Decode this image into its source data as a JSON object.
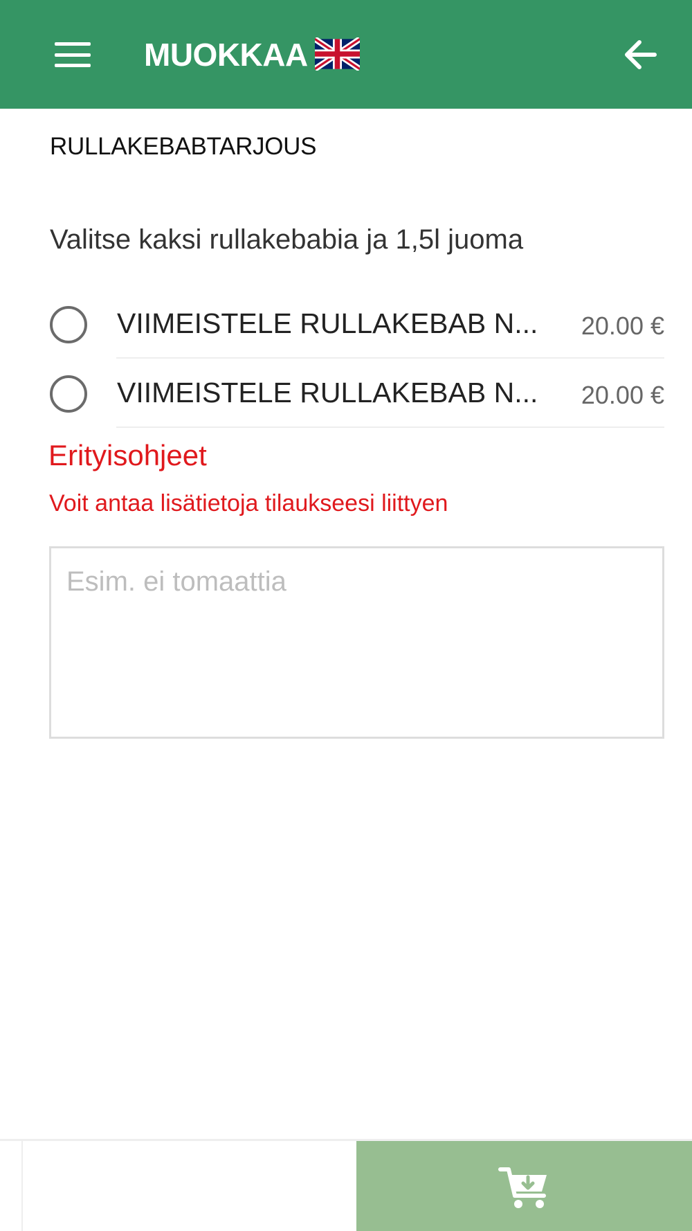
{
  "header": {
    "title": "MUOKKAA",
    "menu_icon": "hamburger-menu-icon",
    "language_icon": "uk-flag-icon",
    "back_icon": "arrow-left-icon",
    "background_color": "#359564"
  },
  "product": {
    "title": "RULLAKEBABTARJOUS",
    "instruction": "Valitse kaksi rullakebabia ja 1,5l juoma"
  },
  "options": [
    {
      "label": "VIIMEISTELE RULLAKEBAB N...",
      "price": "20.00 €",
      "selected": false
    },
    {
      "label": "VIIMEISTELE RULLAKEBAB N...",
      "price": "20.00 €",
      "selected": false
    }
  ],
  "special_instructions": {
    "title": "Erityisohjeet",
    "description": "Voit antaa lisätietoja tilaukseesi liittyen",
    "placeholder": "Esim. ei tomaattia",
    "value": "",
    "accent_color": "#e0191d"
  },
  "footer": {
    "cart_icon": "add-to-cart-icon",
    "button_color": "#97be91"
  }
}
